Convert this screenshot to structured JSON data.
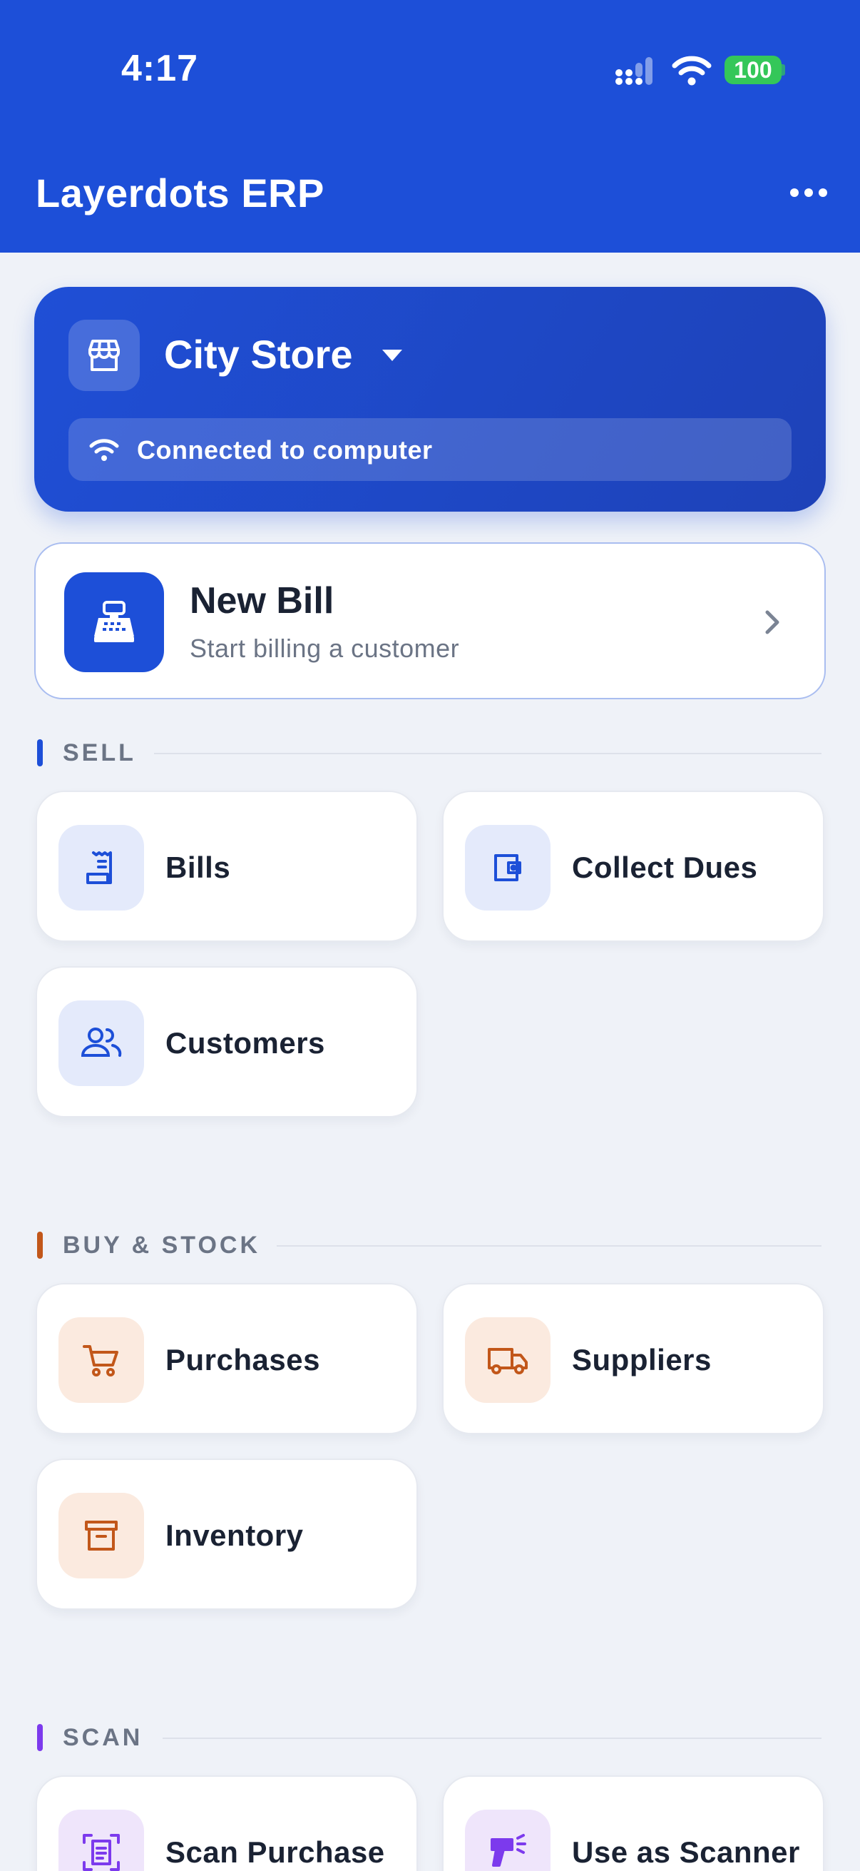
{
  "status_bar": {
    "time": "4:17",
    "battery": "100"
  },
  "app_bar": {
    "title": "Layerdots ERP"
  },
  "store": {
    "name": "City Store",
    "connection": "Connected to computer"
  },
  "new_bill": {
    "title": "New Bill",
    "subtitle": "Start billing a customer"
  },
  "sections": {
    "sell": {
      "label": "SELL",
      "accent": "#1d4fd8",
      "tiles": [
        {
          "label": "Bills",
          "icon": "receipt-icon"
        },
        {
          "label": "Collect Dues",
          "icon": "wallet-icon"
        },
        {
          "label": "Customers",
          "icon": "users-icon"
        }
      ]
    },
    "buy_stock": {
      "label": "BUY & STOCK",
      "accent": "#c2571a",
      "tiles": [
        {
          "label": "Purchases",
          "icon": "cart-icon"
        },
        {
          "label": "Suppliers",
          "icon": "truck-icon"
        },
        {
          "label": "Inventory",
          "icon": "archive-box-icon"
        }
      ]
    },
    "scan": {
      "label": "SCAN",
      "accent": "#7c3aed",
      "tiles": [
        {
          "label": "Scan Purchase",
          "icon": "document-scan-icon"
        },
        {
          "label": "Use as Scanner",
          "icon": "barcode-scanner-icon"
        }
      ]
    }
  },
  "colors": {
    "primary": "#1d4fd8",
    "background": "#eff2f8",
    "orange": "#c2571a",
    "purple": "#7c3aed",
    "battery": "#34c759"
  }
}
